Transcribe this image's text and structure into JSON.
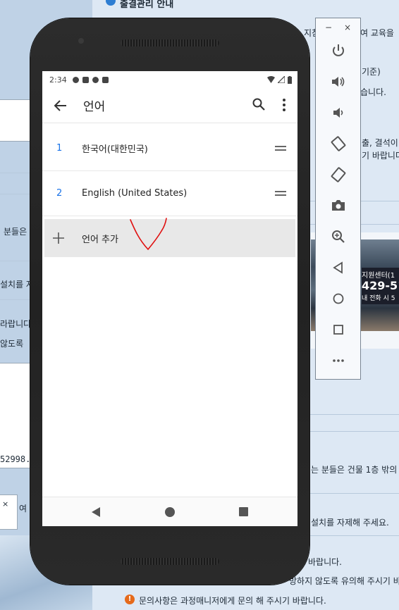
{
  "background": {
    "heading": "출결관리 안내",
    "fragments": {
      "t1": "지침",
      "t2": "여 교육을",
      "t3": "기준)",
      "t4": "습니다.",
      "t5": "출, 결석이",
      "t6": "기 바랍니다",
      "t7": "분들은",
      "t8": "설치를 자",
      "t9": "라랍니다.",
      "t10": "않도록",
      "t11": "52998.",
      "t12": "여 :",
      "t13": "는 분들은 건물 1층 밖의",
      "t14": "설치를 자제해 주세요.",
      "t15": "바랍니다.",
      "t16": "방하지 않도록 유의해 주시기 바",
      "t17": "문의사항은 과정매니저에게 문의 해 주시기 바랍니다."
    },
    "photo_text": {
      "line1": "지원센터(1",
      "line2": "429-51",
      "line3": "내 전화 시 5"
    },
    "window_close": "×"
  },
  "statusbar": {
    "time": "2:34"
  },
  "appbar": {
    "title": "언어"
  },
  "languages": [
    {
      "num": "1",
      "name": "한국어(대한민국)"
    },
    {
      "num": "2",
      "name": "English (United States)"
    }
  ],
  "add_language": {
    "label": "언어 추가"
  },
  "emulator": {
    "minimize": "−",
    "close": "×"
  },
  "colors": {
    "accent": "#1a73e8",
    "annotation": "#e01010",
    "warning": "#e56a1b"
  }
}
